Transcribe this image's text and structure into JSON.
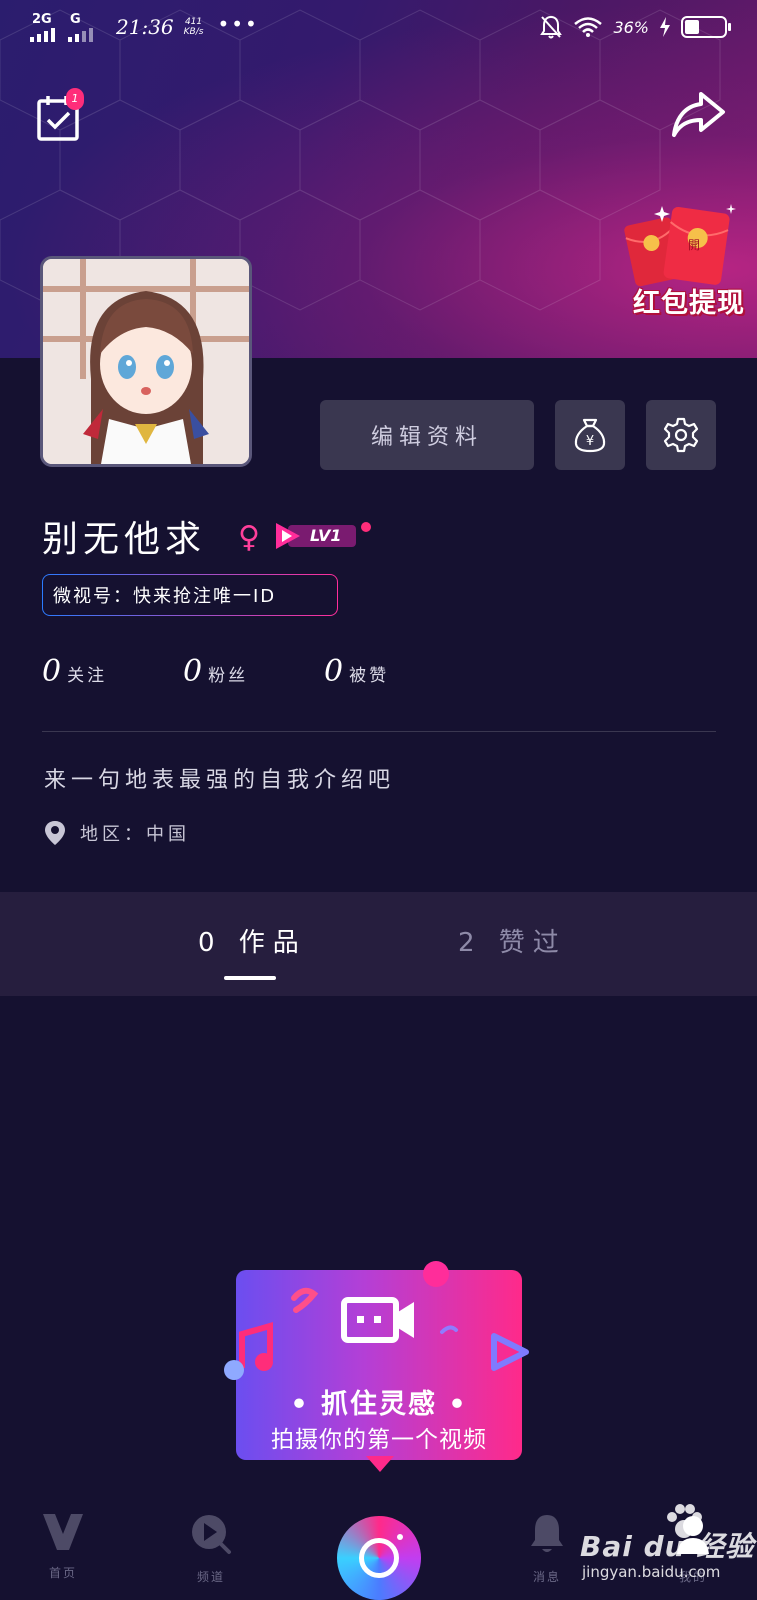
{
  "status_bar": {
    "signal1_label": "2G",
    "signal2_label": "G",
    "time": "21:36",
    "net_speed_value": "411",
    "net_speed_unit": "KB/s",
    "more": "•••",
    "battery_text": "36%",
    "battery_level": 0.36
  },
  "header": {
    "checkin_badge": "1",
    "red_packet_sign": "開",
    "red_packet_label": "红包提现"
  },
  "profile": {
    "username": "别无他求",
    "gender_symbol": "♀",
    "level": "LV1",
    "weishi_id": "微视号：快来抢注唯一ID",
    "edit_label": "编辑资料",
    "wallet_symbol": "¥",
    "stats": [
      {
        "count": "0",
        "label": "关注"
      },
      {
        "count": "0",
        "label": "粉丝"
      },
      {
        "count": "0",
        "label": "被赞"
      }
    ],
    "bio": "来一句地表最强的自我介绍吧",
    "region": "地区：中国"
  },
  "tabs": {
    "works": "0 作品",
    "liked": "2 赞过"
  },
  "promo": {
    "title": "• 抓住灵感 •",
    "subtitle": "拍摄你的第一个视频"
  },
  "bottom_nav": {
    "home": "首页",
    "channel": "频道",
    "messages": "消息",
    "me": "我的"
  },
  "watermark": {
    "brand": "Bai du 经验",
    "url": "jingyan.baidu.com"
  },
  "colors": {
    "background": "#151130",
    "accent": "#ff2d7a",
    "button": "#3a3750"
  }
}
